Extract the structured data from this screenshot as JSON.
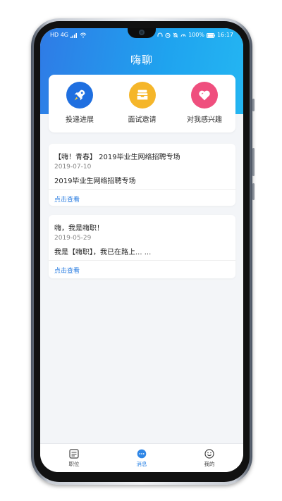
{
  "status_bar": {
    "carrier": "HD 4G",
    "battery": "100%",
    "time": "16:17"
  },
  "header": {
    "title": "嗨聊"
  },
  "quick_actions": [
    {
      "label": "投递进展",
      "icon": "rocket-icon",
      "color": "#1f6fe0"
    },
    {
      "label": "面试邀请",
      "icon": "inbox-icon",
      "color": "#f5b62a"
    },
    {
      "label": "对我感兴趣",
      "icon": "heart-icon",
      "color": "#ef4f7e"
    }
  ],
  "messages": [
    {
      "title": "【嗨！青春】 2019毕业生网络招聘专场",
      "date": "2019-07-10",
      "description": "2019毕业生网络招聘专场",
      "link": "点击查看"
    },
    {
      "title": "嗨，我是嗨职！",
      "date": "2019-05-29",
      "description": "我是【嗨职】，我已在路上... ...",
      "link": "点击查看"
    }
  ],
  "tabs": [
    {
      "label": "职位",
      "icon": "job-list-icon",
      "active": false
    },
    {
      "label": "消息",
      "icon": "message-icon",
      "active": true
    },
    {
      "label": "我的",
      "icon": "smile-icon",
      "active": false
    }
  ],
  "colors": {
    "accent": "#2f86e6",
    "link": "#2a7de1",
    "background": "#f3f5f8"
  }
}
